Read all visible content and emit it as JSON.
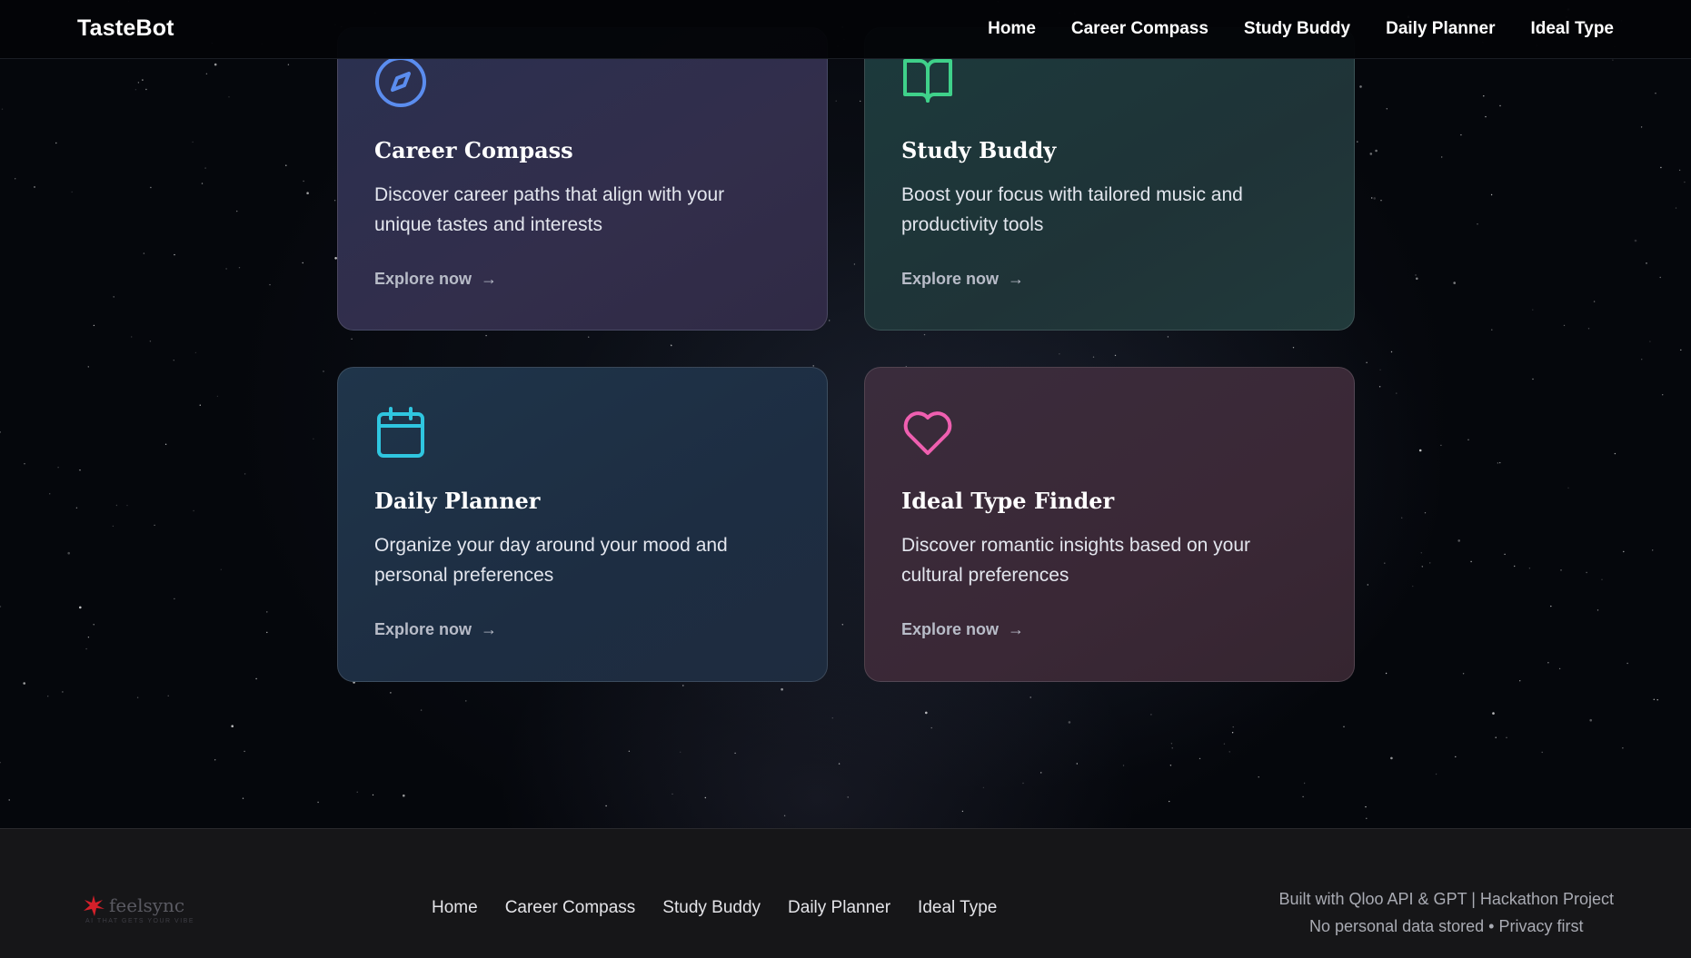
{
  "header": {
    "brand": "TasteBot",
    "nav": [
      "Home",
      "Career Compass",
      "Study Buddy",
      "Daily Planner",
      "Ideal Type"
    ]
  },
  "cards": [
    {
      "icon": "compass-icon",
      "color": "#5b8def",
      "title": "Career Compass",
      "description": "Discover career paths that align with your unique tastes and interests",
      "cta": "Explore now",
      "arrow": "→"
    },
    {
      "icon": "book-open-icon",
      "color": "#3fd18a",
      "title": "Study Buddy",
      "description": "Boost your focus with tailored music and productivity tools",
      "cta": "Explore now",
      "arrow": "→"
    },
    {
      "icon": "calendar-icon",
      "color": "#2fc6e0",
      "title": "Daily Planner",
      "description": "Organize your day around your mood and personal preferences",
      "cta": "Explore now",
      "arrow": "→"
    },
    {
      "icon": "heart-icon",
      "color": "#ef5fb0",
      "title": "Ideal Type Finder",
      "description": "Discover romantic insights based on your cultural preferences",
      "cta": "Explore now",
      "arrow": "→"
    }
  ],
  "footer": {
    "logo_name": "feelsync",
    "logo_tagline": "AI THAT GETS YOUR VIBE",
    "logo_color": "#d4202a",
    "nav": [
      "Home",
      "Career Compass",
      "Study Buddy",
      "Daily Planner",
      "Ideal Type"
    ],
    "note_line1": "Built with Qloo API & GPT | Hackathon Project",
    "note_line2": "No personal data stored • Privacy first"
  }
}
